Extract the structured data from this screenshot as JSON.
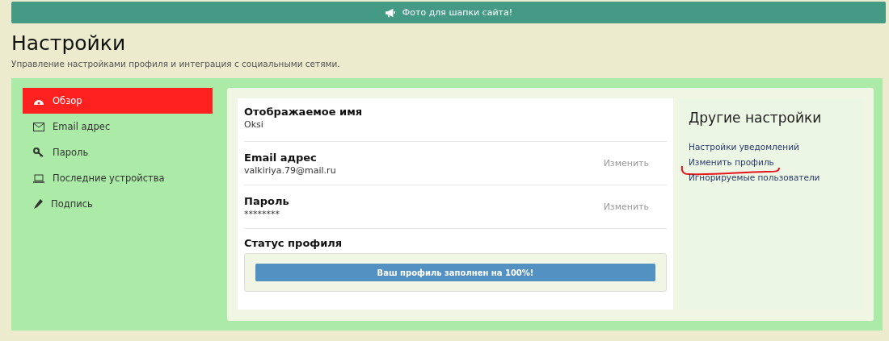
{
  "banner": {
    "text": "Фото для шапки сайта!"
  },
  "page": {
    "title": "Настройки",
    "subtitle": "Управление настройками профиля и интеграция с социальными сетями."
  },
  "sidebar": {
    "items": [
      {
        "label": "Обзор",
        "kind": "gauge",
        "selected": true
      },
      {
        "label": "Email адрес",
        "kind": "envelope",
        "selected": false
      },
      {
        "label": "Пароль",
        "kind": "key",
        "selected": false
      },
      {
        "label": "Последние устройства",
        "kind": "laptop",
        "selected": false
      },
      {
        "label": "Подпись",
        "kind": "pencil",
        "selected": false
      }
    ]
  },
  "fields": [
    {
      "label": "Отображаемое имя",
      "value": "Oksi"
    },
    {
      "label": "Email адрес",
      "value": "valkiriya.79@mail.ru",
      "action": "Изменить"
    },
    {
      "label": "Пароль",
      "value": "********",
      "action": "Изменить"
    }
  ],
  "profile_status": {
    "label": "Статус профиля",
    "text": "Ваш профиль заполнен на 100%!",
    "level": 1
  },
  "other_settings": {
    "title": "Другие настройки",
    "links": [
      {
        "label": "Настройки уведомлений",
        "underlined": false
      },
      {
        "label": "Изменить профиль",
        "underlined": true
      },
      {
        "label": "Игнорируемые пользователи",
        "underlined": false
      }
    ]
  }
}
